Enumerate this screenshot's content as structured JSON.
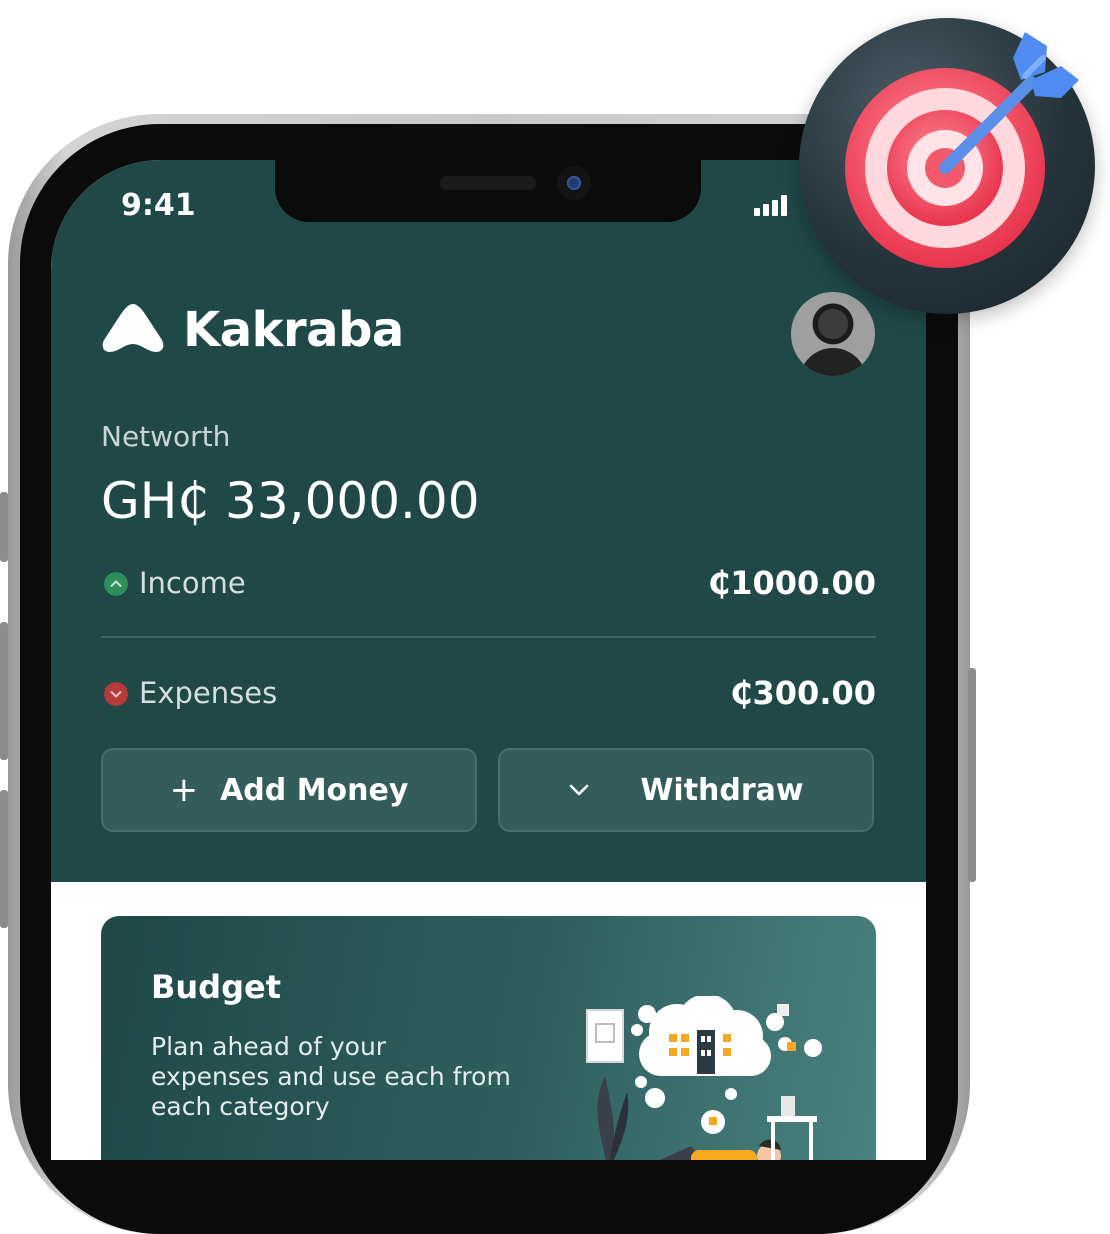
{
  "status_bar": {
    "time": "9:41"
  },
  "header": {
    "brand_name": "Kakraba"
  },
  "networth": {
    "label": "Networth",
    "value": "GH₵ 33,000.00"
  },
  "income": {
    "label": "Income",
    "value": "₵1000.00"
  },
  "expenses": {
    "label": "Expenses",
    "value": "₵300.00"
  },
  "actions": {
    "add_money": "Add Money",
    "withdraw": "Withdraw"
  },
  "budget": {
    "title": "Budget",
    "description": "Plan ahead of your expenses and use each from each category"
  },
  "colors": {
    "hero_bg": "#1f4847",
    "income_indicator": "#2f8f5c",
    "expense_indicator": "#b53a3a",
    "target_red": "#f04a5e"
  },
  "icons": {
    "logo": "kakraba-logo-icon",
    "income": "arrow-up-circle-icon",
    "expenses": "arrow-down-circle-icon",
    "add": "plus-icon",
    "withdraw": "chevron-down-icon",
    "badge": "target-dart-icon"
  }
}
